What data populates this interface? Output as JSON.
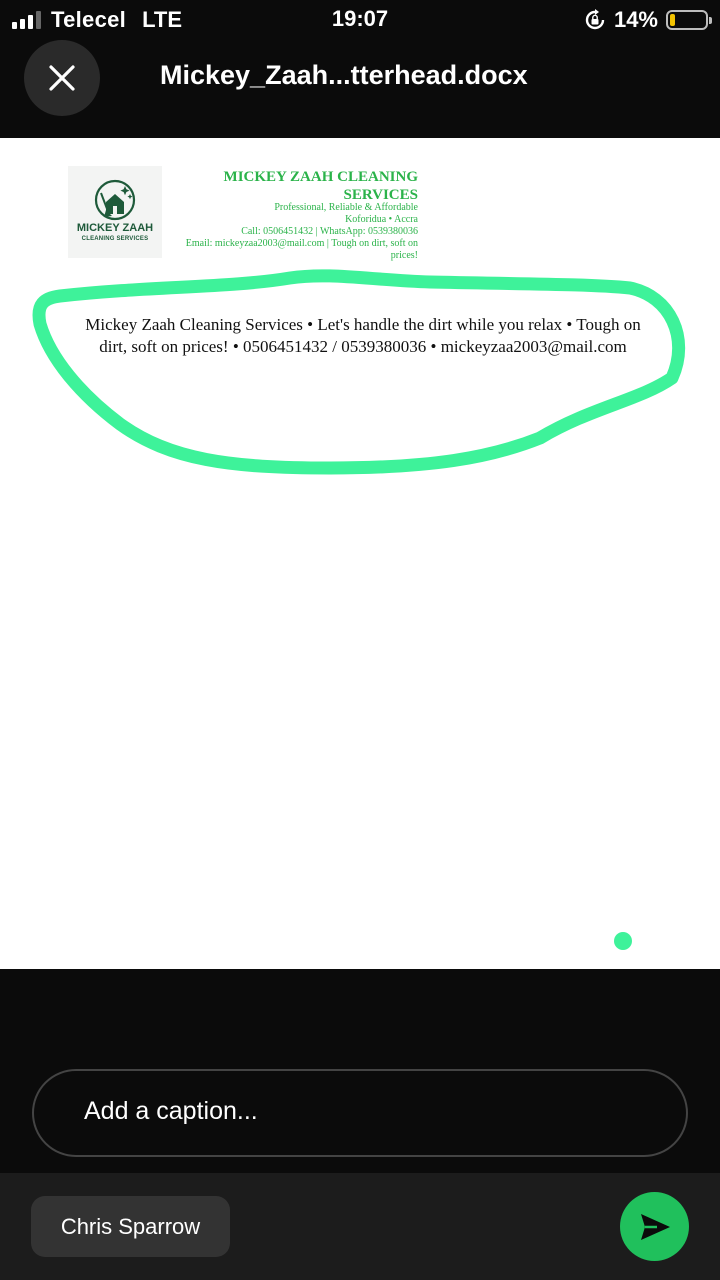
{
  "status_bar": {
    "carrier": "Telecel",
    "network": "LTE",
    "time": "19:07",
    "battery_percent": "14%",
    "battery_level": 0.14,
    "battery_color": "#f2c200",
    "icons": [
      "signal-icon",
      "rotation-lock-icon",
      "battery-icon"
    ]
  },
  "header": {
    "close_icon": "close-icon",
    "file_title": "Mickey_Zaah...tterhead.docx"
  },
  "document": {
    "logo": {
      "name": "MICKEY ZAAH",
      "subtitle": "CLEANING SERVICES"
    },
    "letterhead": {
      "title_line1": "MICKEY ZAAH CLEANING",
      "title_line2": "SERVICES",
      "tagline": "Professional, Reliable & Affordable",
      "location": "Koforidua • Accra",
      "phones": "Call: 0506451432   |   WhatsApp: 0539380036",
      "email_line1": "Email: mickeyzaa2003@mail.com  |  Tough on dirt, soft on",
      "email_line2": "prices!"
    },
    "body_text": "Mickey Zaah Cleaning Services • Let's handle the dirt while you relax • Tough on dirt, soft on prices! • 0506451432 / 0539380036 • mickeyzaa2003@mail.com",
    "annotation_color": "#3ef29a",
    "brand_green": "#2bb34a"
  },
  "caption": {
    "placeholder": "Add a caption..."
  },
  "bottom_bar": {
    "recipient": "Chris Sparrow",
    "send_icon": "send-icon",
    "send_color": "#20c05c"
  }
}
